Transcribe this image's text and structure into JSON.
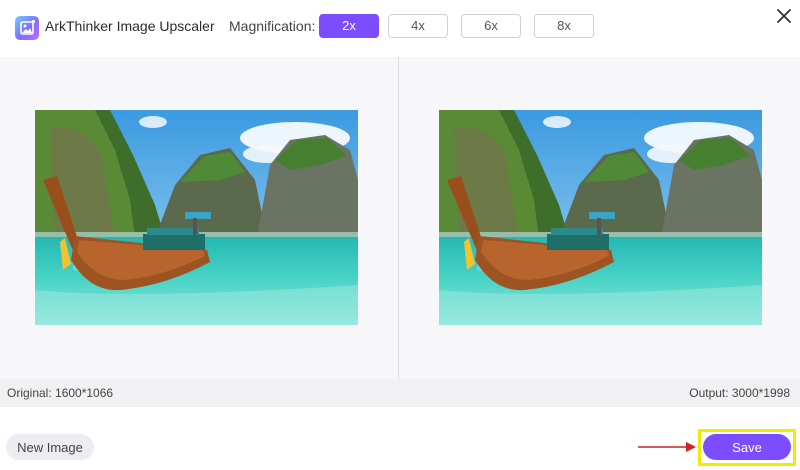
{
  "app": {
    "title": "ArkThinker Image Upscaler",
    "logo_icon": "image-icon"
  },
  "magnification": {
    "label": "Magnification:",
    "options": [
      "2x",
      "4x",
      "6x",
      "8x"
    ],
    "selected": "2x"
  },
  "window": {
    "close_icon": "close-icon"
  },
  "preview": {
    "original_label": "Original: 1600*1066",
    "output_label": "Output: 3000*1998"
  },
  "footer": {
    "new_image_label": "New Image",
    "save_label": "Save"
  },
  "colors": {
    "accent": "#7c4dff",
    "highlight": "#f2ea00",
    "arrow": "#d42020"
  }
}
